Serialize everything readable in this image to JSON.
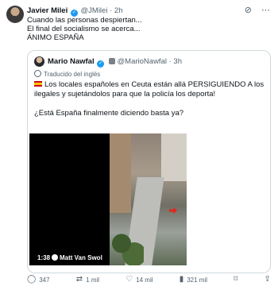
{
  "tweet": {
    "author_name": "Javier Milei",
    "handle": "@JMilei",
    "separator": "·",
    "time": "2h",
    "lines": [
      "Cuando las personas despiertan...",
      "El final del socialismo se acerca...",
      "ÁNIMO ESPAÑA"
    ]
  },
  "quote": {
    "author_name": "Mario Nawfal",
    "handle": "@MarioNawfal",
    "separator": "·",
    "time": "3h",
    "translate_label": "Traducido del inglés",
    "lines": [
      "Los locales españoles en Ceuta están allá PERSIGUIENDO A los",
      "ilegales y sujetándolos para que la policía los deporta!",
      "",
      "¿Está España finalmente diciendo basta ya?"
    ],
    "video": {
      "duration": "1:38",
      "credit": "Matt Van Swol"
    }
  },
  "actions": {
    "replies": "347",
    "reposts": "1 mil",
    "likes": "14 mil",
    "views": "321 mil"
  },
  "icons": {
    "top_left": "grok-icon",
    "top_right": "more-icon",
    "reply": "reply-icon",
    "repost": "repost-icon",
    "like": "heart-icon",
    "views": "views-icon",
    "bookmark": "bookmark-icon",
    "share": "share-icon"
  },
  "colors": {
    "verified": "#1d9bf0",
    "secondary_text": "#536471",
    "border": "#cfd9de"
  }
}
